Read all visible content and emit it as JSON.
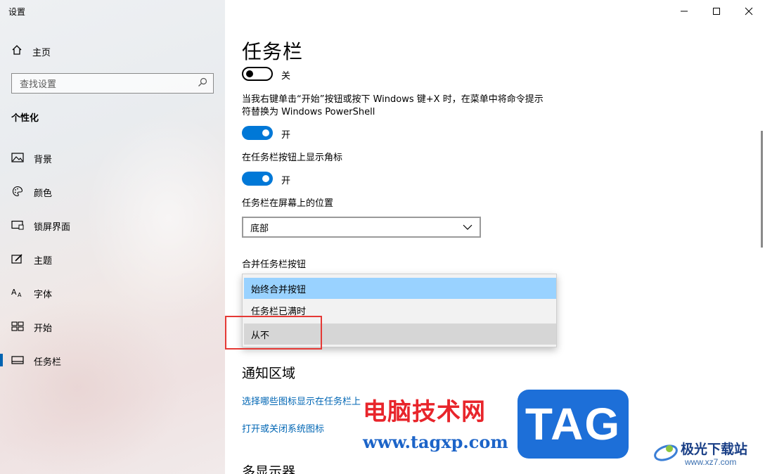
{
  "app": {
    "title": "设置"
  },
  "sidebar": {
    "home_label": "主页",
    "search_placeholder": "查找设置",
    "section_title": "个性化",
    "items": [
      {
        "label": "背景",
        "icon": "image-icon"
      },
      {
        "label": "颜色",
        "icon": "palette-icon"
      },
      {
        "label": "锁屏界面",
        "icon": "lock-screen-icon"
      },
      {
        "label": "主题",
        "icon": "theme-icon"
      },
      {
        "label": "字体",
        "icon": "font-icon"
      },
      {
        "label": "开始",
        "icon": "start-icon"
      },
      {
        "label": "任务栏",
        "icon": "taskbar-icon",
        "selected": true
      }
    ]
  },
  "main": {
    "title": "任务栏",
    "toggle1": {
      "state": "关"
    },
    "powershell_desc": "当我右键单击“开始”按钮或按下 Windows 键+X 时，在菜单中将命令提示符替换为 Windows PowerShell",
    "toggle2": {
      "state": "开"
    },
    "badges_label": "在任务栏按钮上显示角标",
    "toggle3": {
      "state": "开"
    },
    "position_label": "任务栏在屏幕上的位置",
    "position_value": "底部",
    "combine_label": "合并任务栏按钮",
    "combine_options": [
      "始终合并按钮",
      "任务栏已满时",
      "从不"
    ],
    "combine_selected": "始终合并按钮",
    "notification_heading": "通知区域",
    "link_select_icons": "选择哪些图标显示在任务栏上",
    "link_system_icons": "打开或关闭系统图标",
    "multi_display_heading": "多显示器"
  },
  "watermark": {
    "cn": "电脑技术网",
    "url": "www.tagxp.com",
    "tag": "TAG",
    "site": "极光下载站",
    "site_url": "www.xz7.com"
  },
  "colors": {
    "accent": "#0078d7",
    "selected_option": "#99d2ff",
    "highlight_box": "#e53935",
    "link": "#0066b4"
  }
}
